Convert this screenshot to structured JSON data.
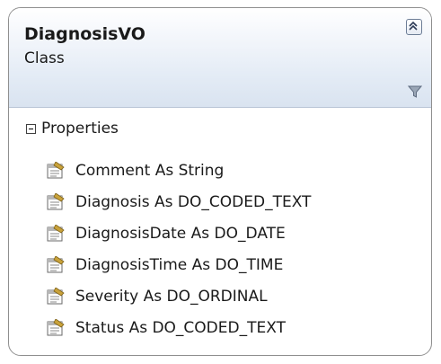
{
  "class": {
    "name": "DiagnosisVO",
    "stereotype": "Class"
  },
  "icons": {
    "collapse": "double-chevron-up-icon",
    "filter": "filter-icon",
    "property": "property-icon",
    "section_toggle": "minus-box-icon"
  },
  "colors": {
    "border": "#8f8f8f",
    "header_bottom": "#d9e3f0"
  },
  "sections": [
    {
      "label": "Properties",
      "items": [
        "Comment As String",
        "Diagnosis As DO_CODED_TEXT",
        "DiagnosisDate As DO_DATE",
        "DiagnosisTime As DO_TIME",
        "Severity As DO_ORDINAL",
        "Status As DO_CODED_TEXT"
      ]
    }
  ]
}
